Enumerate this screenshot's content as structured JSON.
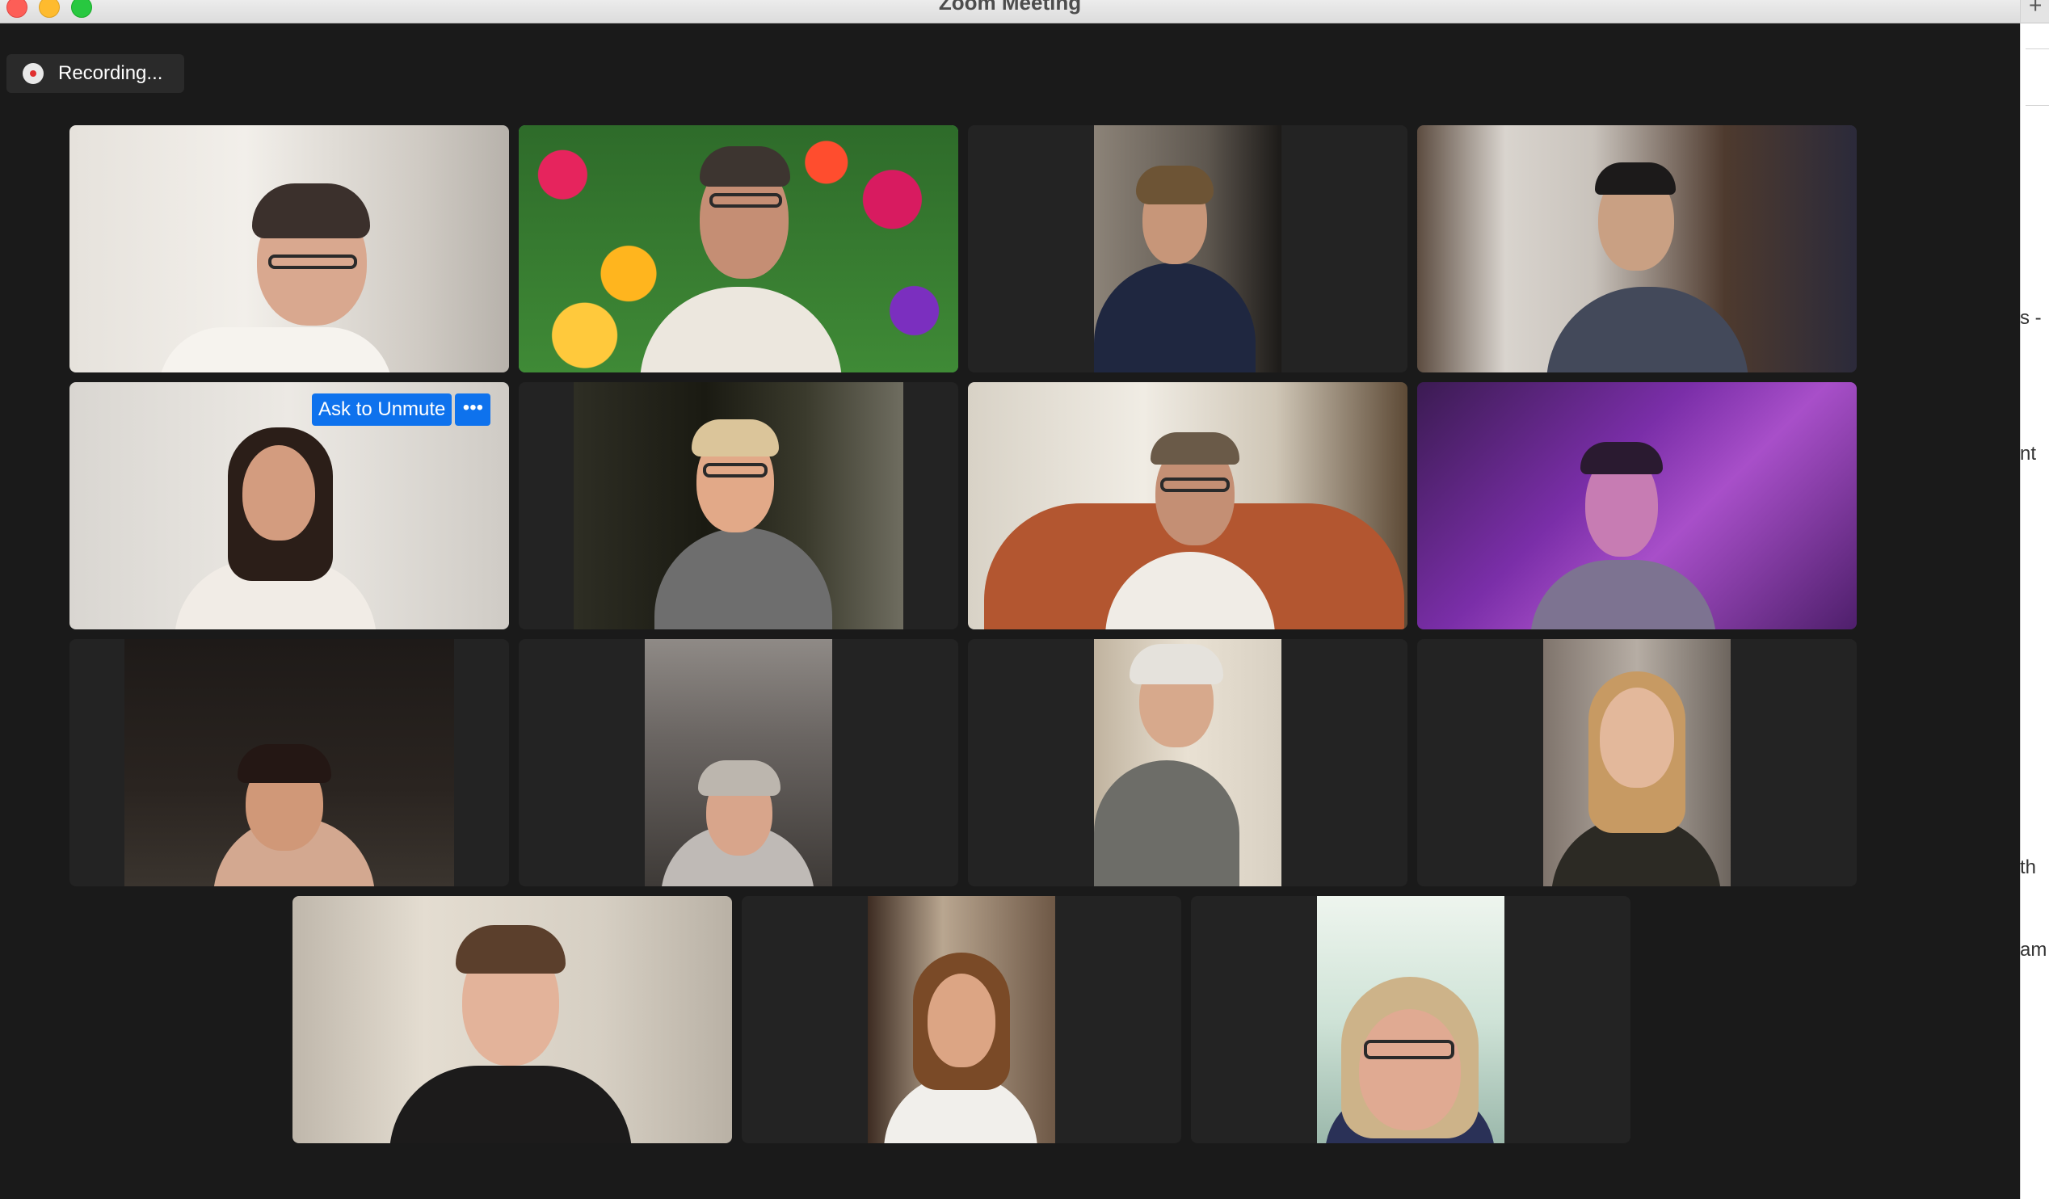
{
  "window": {
    "title": "Zoom Meeting"
  },
  "recording": {
    "label": "Recording..."
  },
  "tile_controls": {
    "ask_to_unmute_label": "Ask to Unmute",
    "more_label": "•••"
  },
  "side_panel": {
    "fragments": [
      "s -",
      "nt",
      "th",
      "am"
    ]
  },
  "colors": {
    "active_speaker_border": "#34d058",
    "unmute_button": "#0e72ed",
    "background": "#1a1a1a",
    "tile": "#232323"
  },
  "participants_count": 15
}
